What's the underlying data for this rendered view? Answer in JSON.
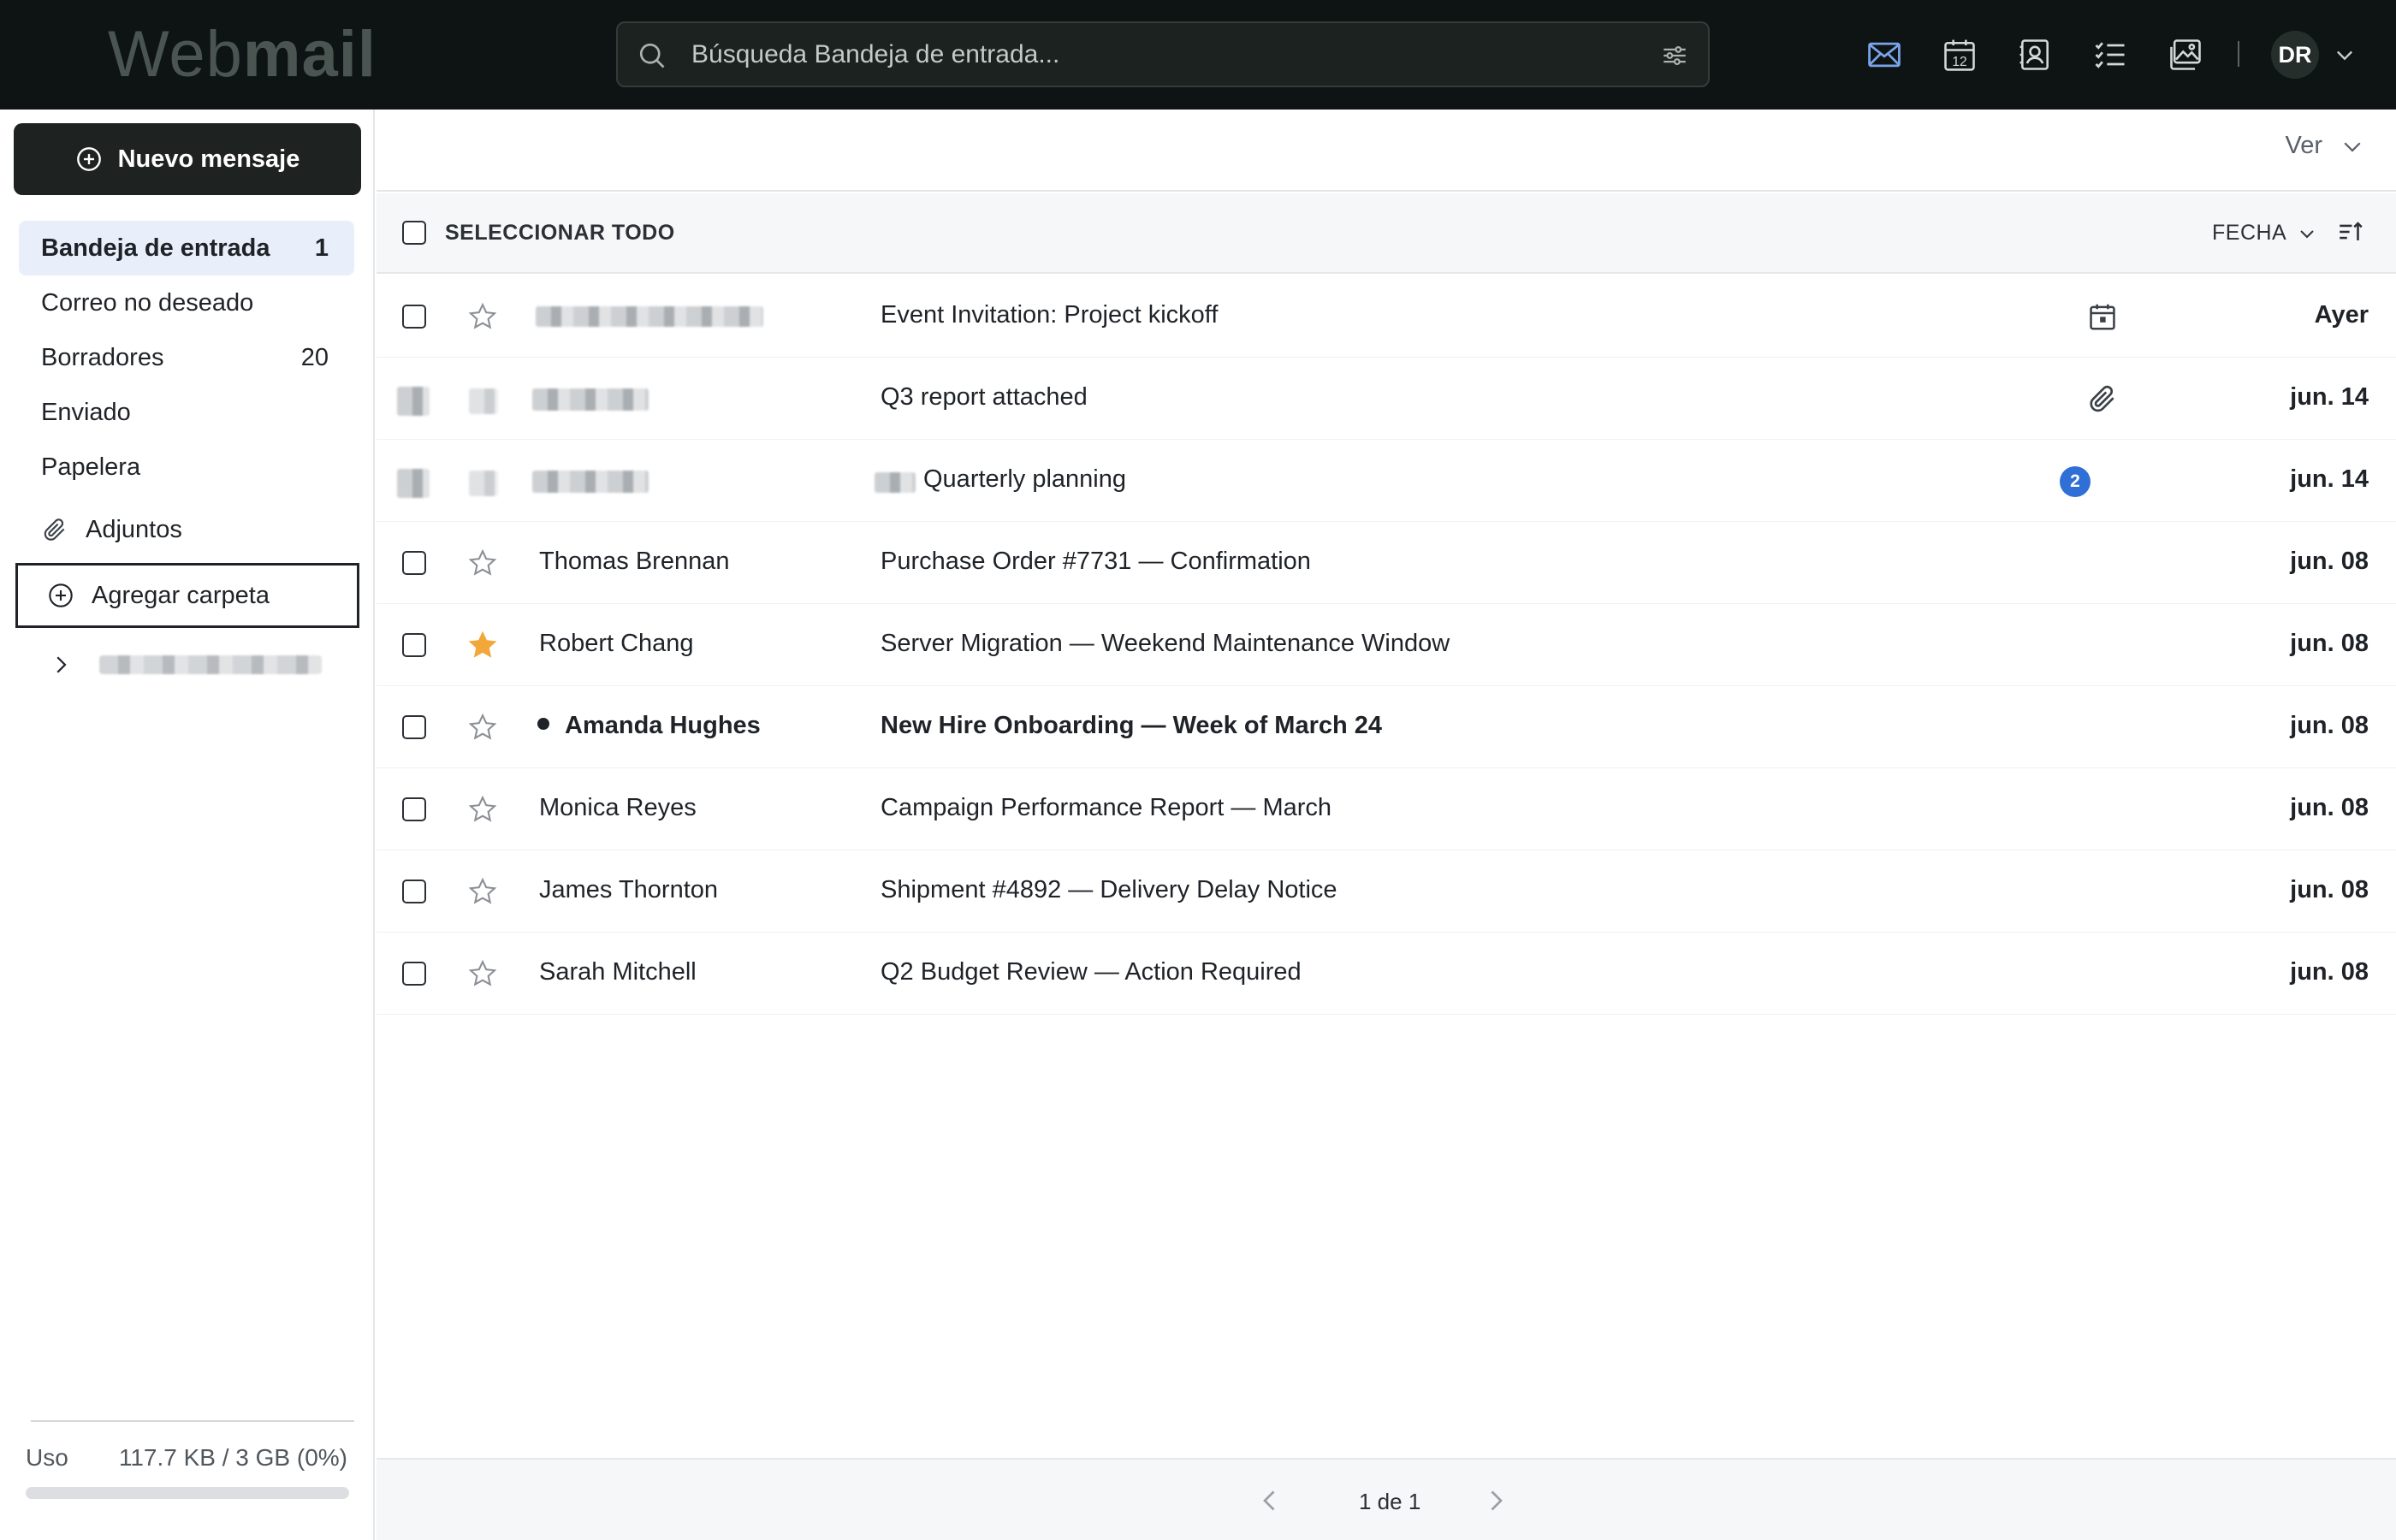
{
  "app": {
    "logo_thin": "Web",
    "logo_bold": "mail"
  },
  "search": {
    "placeholder": "Búsqueda Bandeja de entrada..."
  },
  "header": {
    "apps": [
      "mail-icon",
      "calendar-icon",
      "contacts-icon",
      "tasks-icon",
      "photos-icon"
    ],
    "calendar_day": "12",
    "avatar_initials": "DR",
    "accent": "#2f6fd6"
  },
  "sidebar": {
    "compose_label": "Nuevo mensaje",
    "folders": [
      {
        "label": "Bandeja de entrada",
        "count": "1"
      },
      {
        "label": "Correo no deseado",
        "count": ""
      },
      {
        "label": "Borradores",
        "count": "20"
      },
      {
        "label": "Enviado",
        "count": ""
      },
      {
        "label": "Papelera",
        "count": ""
      }
    ],
    "attachments_label": "Adjuntos",
    "add_folder_label": "Agregar carpeta",
    "usage_label": "Uso",
    "usage_value": "117.7 KB / 3 GB (0%)",
    "usage_fraction": 0
  },
  "toolbar": {
    "view_label": "Ver",
    "select_all_label": "SELECCIONAR TODO",
    "sort_label": "FECHA"
  },
  "messages": [
    {
      "sender": "",
      "subject": "Event Invitation: Project kickoff",
      "date": "Ayer",
      "unread": false,
      "starred": false,
      "meta": "calendar-icon"
    },
    {
      "sender": "",
      "subject": "Q3 report attached",
      "date": "jun. 14",
      "unread": false,
      "starred": false,
      "meta": "paperclip-icon"
    },
    {
      "sender": "",
      "subject": "Quarterly planning",
      "date": "jun. 14",
      "unread": false,
      "starred": false,
      "meta": "thread-count",
      "thread_count": "2"
    },
    {
      "sender": "Thomas Brennan",
      "subject": "Purchase Order #7731 — Confirmation",
      "date": "jun. 08",
      "unread": false,
      "starred": false,
      "meta": ""
    },
    {
      "sender": "Robert Chang",
      "subject": "Server Migration — Weekend Maintenance Window",
      "date": "jun. 08",
      "unread": false,
      "starred": true,
      "meta": ""
    },
    {
      "sender": "Amanda Hughes",
      "subject": "New Hire Onboarding — Week of March 24",
      "date": "jun. 08",
      "unread": true,
      "starred": false,
      "meta": ""
    },
    {
      "sender": "Monica Reyes",
      "subject": "Campaign Performance Report — March",
      "date": "jun. 08",
      "unread": false,
      "starred": false,
      "meta": ""
    },
    {
      "sender": "James Thornton",
      "subject": "Shipment #4892 — Delivery Delay Notice",
      "date": "jun. 08",
      "unread": false,
      "starred": false,
      "meta": ""
    },
    {
      "sender": "Sarah Mitchell",
      "subject": "Q2 Budget Review — Action Required",
      "date": "jun. 08",
      "unread": false,
      "starred": false,
      "meta": ""
    }
  ],
  "pagination": {
    "label": "1 de 1"
  }
}
